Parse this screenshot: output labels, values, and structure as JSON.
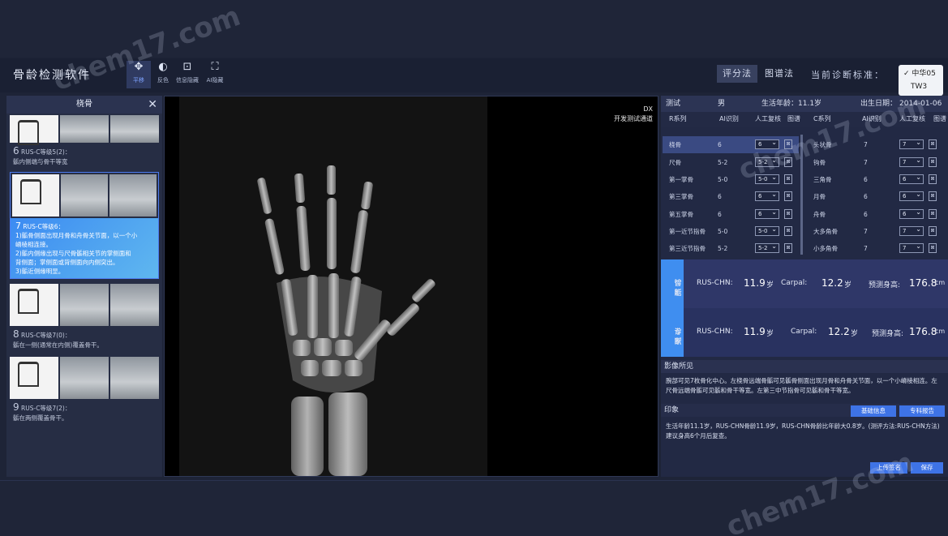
{
  "app": {
    "title": "骨龄检测软件"
  },
  "toolbar": {
    "tools": [
      {
        "label": "平移",
        "icon": "move-icon"
      },
      {
        "label": "反色",
        "icon": "contrast-icon"
      },
      {
        "label": "信息隐藏",
        "icon": "info-hide-icon"
      },
      {
        "label": "AI隐藏",
        "icon": "ai-hide-icon"
      }
    ],
    "method_tabs": [
      "评分法",
      "图谱法"
    ],
    "standard_label": "当前诊断标准：",
    "standard_options": [
      "✓ 中华05",
      "TW3"
    ]
  },
  "left_panel": {
    "title": "桡骨",
    "stages": [
      {
        "num": "6",
        "code": "RUS-C等级5(2)：",
        "desc": "骺内侧端与骨干等宽"
      },
      {
        "num": "7",
        "code": "RUS-C等级6：",
        "desc_lines": [
          "1)骺骨侧面出现月骨和舟骨关节面，以一个小",
          "嵴棱相连接。",
          "2)骺内侧缘出现与尺骨骺相关节的掌侧面和",
          "背侧面；掌侧面或背侧面向内侧突出。",
          "3)骺近侧缘明显。"
        ]
      },
      {
        "num": "8",
        "code": "RUS-C等级7(0)：",
        "desc": "骺在一侧(通常在内侧)覆盖骨干。"
      },
      {
        "num": "9",
        "code": "RUS-C等级7(2)：",
        "desc": "骺在两侧覆盖骨干。"
      }
    ]
  },
  "viewer": {
    "dx": "DX",
    "channel": "开发测试通道"
  },
  "patient": {
    "name": "测试",
    "sex": "男",
    "age_label": "生活年龄：11.1岁",
    "birth_label": "出生日期：",
    "birth": "2014-01-06"
  },
  "table": {
    "r_header": [
      "R系列",
      "AI识别",
      "人工复核",
      "图谱"
    ],
    "c_header": [
      "C系列",
      "AI识别",
      "人工复核",
      "图谱"
    ],
    "r_rows": [
      {
        "name": "桡骨",
        "ai": "6",
        "manual": "6"
      },
      {
        "name": "尺骨",
        "ai": "5-2",
        "manual": "5-2"
      },
      {
        "name": "第一掌骨",
        "ai": "5-0",
        "manual": "5-0"
      },
      {
        "name": "第三掌骨",
        "ai": "6",
        "manual": "6"
      },
      {
        "name": "第五掌骨",
        "ai": "6",
        "manual": "6"
      },
      {
        "name": "第一近节指骨",
        "ai": "5-0",
        "manual": "5-0"
      },
      {
        "name": "第三近节指骨",
        "ai": "5-2",
        "manual": "5-2"
      }
    ],
    "c_rows": [
      {
        "name": "头状骨",
        "ai": "7",
        "manual": "7"
      },
      {
        "name": "钩骨",
        "ai": "7",
        "manual": "7"
      },
      {
        "name": "三角骨",
        "ai": "6",
        "manual": "6"
      },
      {
        "name": "月骨",
        "ai": "6",
        "manual": "6"
      },
      {
        "name": "舟骨",
        "ai": "6",
        "manual": "6"
      },
      {
        "name": "大多角骨",
        "ai": "7",
        "manual": "7"
      },
      {
        "name": "小多角骨",
        "ai": "7",
        "manual": "7"
      }
    ]
  },
  "diagnosis": {
    "smart": {
      "side": [
        "智能",
        "诊断"
      ],
      "rus_label": "RUS-CHN:",
      "rus": "11.9",
      "carpal_label": "Carpal:",
      "carpal": "12.2",
      "height_label": "预测身高:",
      "height": "176.8",
      "unit_age": "岁",
      "unit_cm": "cm"
    },
    "expert": {
      "side": [
        "专家",
        "诊断"
      ],
      "rus_label": "RUS-CHN:",
      "rus": "11.9",
      "carpal_label": "Carpal:",
      "carpal": "12.2",
      "height_label": "预测身高:",
      "height": "176.8",
      "unit_age": "岁",
      "unit_cm": "cm"
    }
  },
  "findings": {
    "title": "影像所见",
    "text": "腕部可见7枚骨化中心。左桡骨远端骨骺可见骺骨侧面出现月骨和舟骨关节面，以一个小嵴棱相连。左尺骨远端骨骺可见骺和骨干等宽。左第三中节指骨可见骺和骨干等宽。"
  },
  "impression": {
    "title": "印象",
    "btn_basic": "基础信息",
    "btn_report": "专科报告",
    "text": "生活年龄11.1岁，RUS-CHN骨龄11.9岁，RUS-CHN骨龄比年龄大0.8岁。(测评方法:RUS-CHN方法)建议身高6个月后复查。"
  },
  "footer": {
    "btn_upload": "上传签名",
    "btn_save": "保存"
  },
  "watermarks": [
    "chem17.com",
    "chem17.com",
    "chem17.com"
  ]
}
